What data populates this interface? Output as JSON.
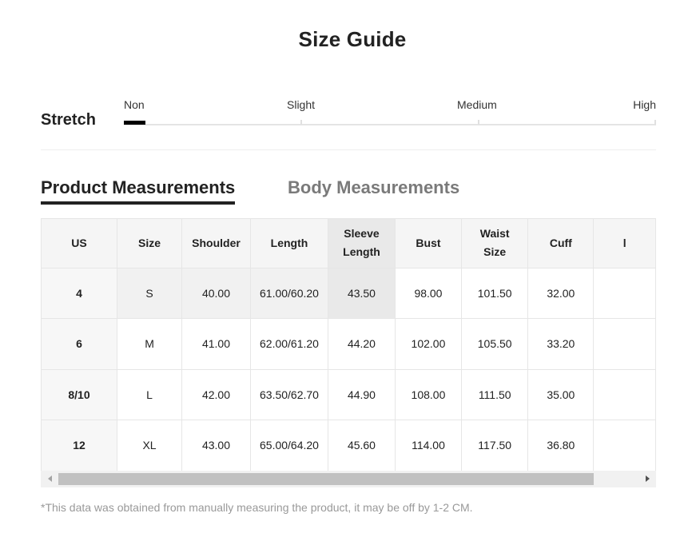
{
  "title": "Size Guide",
  "stretch": {
    "label": "Stretch",
    "levels": [
      "Non",
      "Slight",
      "Medium",
      "High"
    ],
    "selected": "Non",
    "fill_fraction": 0.04
  },
  "tabs": [
    {
      "label": "Product Measurements",
      "active": true
    },
    {
      "label": "Body Measurements",
      "active": false
    }
  ],
  "table": {
    "headers": [
      "US",
      "Size",
      "Shoulder",
      "Length",
      "Sleeve\nLength",
      "Bust",
      "Waist\nSize",
      "Cuff",
      "l"
    ],
    "rows": [
      [
        "4",
        "S",
        "40.00",
        "61.00/60.20",
        "43.50",
        "98.00",
        "101.50",
        "32.00",
        ""
      ],
      [
        "6",
        "M",
        "41.00",
        "62.00/61.20",
        "44.20",
        "102.00",
        "105.50",
        "33.20",
        ""
      ],
      [
        "8/10",
        "L",
        "42.00",
        "63.50/62.70",
        "44.90",
        "108.00",
        "111.50",
        "35.00",
        ""
      ],
      [
        "12",
        "XL",
        "43.00",
        "65.00/64.20",
        "45.60",
        "114.00",
        "117.50",
        "36.80",
        ""
      ]
    ],
    "highlight_row": 0,
    "highlight_col": 4
  },
  "scroll": {
    "thumb_fraction": 0.87,
    "position_fraction": 0.0
  },
  "note": "*This data was obtained from manually measuring the product, it may be off by 1-2 CM.",
  "colors": {
    "accent": "#000000",
    "highlight": "#e9e9e9",
    "muted": "#999999"
  }
}
